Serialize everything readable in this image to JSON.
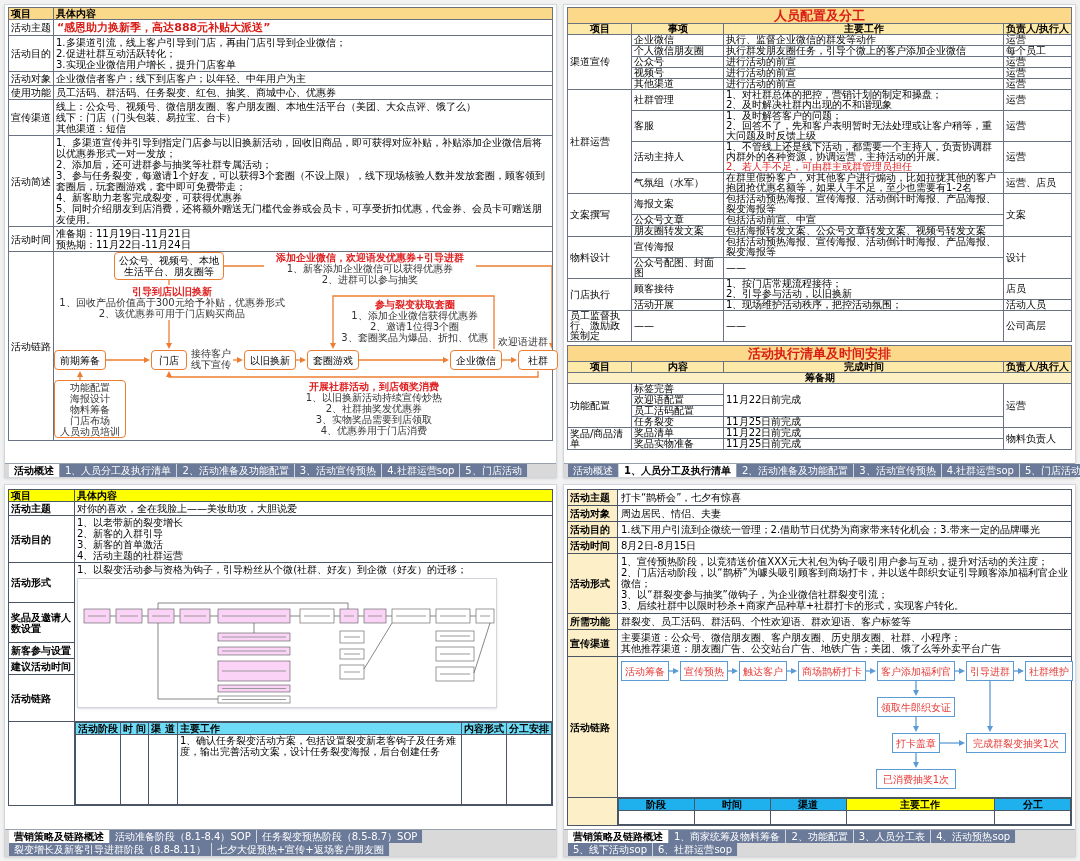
{
  "sheet_1": {
    "header": [
      "项目",
      "具体内容"
    ],
    "rows": [
      {
        "label": "活动主题",
        "kind": "headline",
        "lines": [
          "“感恩助力换新季，高达888元补贴大派送”"
        ]
      },
      {
        "label": "活动目的",
        "kind": "text",
        "lines": [
          "1.多渠道引流，线上客户引导到门店，再由门店引导到企业微信；",
          "2.促进社群互动活跃转化；",
          "3.实现企业微信用户增长，提升门店客单"
        ]
      },
      {
        "label": "活动对象",
        "kind": "text",
        "lines": [
          "企业微信者客户；线下到店客户；以年轻、中年用户为主"
        ]
      },
      {
        "label": "使用功能",
        "kind": "text",
        "lines": [
          "员工活码、群活码、任务裂变、红包、抽奖、商城中心、优惠券"
        ]
      },
      {
        "label": "宣传渠道",
        "kind": "text",
        "lines": [
          "线上：公众号、视频号、微信朋友圈、客户朋友圈、本地生活平台（美团、大众点评、饿了么）",
          "线下：门店（门头包装、易拉宝、台卡）",
          "其他渠道：短信"
        ]
      },
      {
        "label": "活动简述",
        "kind": "text",
        "lines": [
          "1、多渠道宣传并引导到指定门店参与以旧换新活动，回收旧商品，即可获得对应补贴，补贴添加企业微信后将以优惠券形式一对一发放；",
          "2、添加后，还可进群参与抽奖等社群专属活动；",
          "3、参与任务裂变，每邀请1个好友，可以获得3个套圈（不设上限），线下现场核验人数并发放套圈，顾客领到套圈后，玩套圈游戏，套中即可免费带走；",
          "4、新客助力老客完成裂变，可获得优惠券",
          "5、同时介绍朋友到店消费，还将额外赠送无门槛代金券或会员卡，可享受折扣优惠，代金券、会员卡可赠送朋友使用。"
        ]
      },
      {
        "label": "活动时间",
        "kind": "text",
        "lines": [
          "准备期：11月19日-11月21日",
          "预热期：11月22日-11月24日"
        ]
      }
    ],
    "flow": {
      "label": "活动链路",
      "source": "公众号、视频号、本地生活平台、朋友圈等",
      "steps": [
        "前期筹备",
        "门店",
        "以旧换新",
        "套圈游戏",
        "企业微信",
        "社群"
      ],
      "edge_labels": [
        [
          "接待客户",
          "线下宣传"
        ],
        [
          "欢迎语进群"
        ]
      ],
      "prep_items": [
        "功能配置",
        "海报设计",
        "物料筹备",
        "门店布场",
        "人员动员培训"
      ],
      "notes": [
        {
          "title": "添加企业微信，欢迎语发优惠券+引导进群",
          "items": [
            "1、新客添加企业微信可以获得优惠券",
            "2、进群可以参与抽奖"
          ]
        },
        {
          "title": "引导到店以旧换新",
          "items": [
            "1、回收产品价值高于300元给予补贴，优惠券形式",
            "2、该优惠券可用于门店购买商品"
          ]
        },
        {
          "title": "参与裂变获取套圈",
          "items": [
            "1、添加企业微信获得优惠券",
            "2、邀请1位得3个圈",
            "3、套圈奖品为爆品、折扣、优惠"
          ]
        },
        {
          "title": "开展社群活动，到店领奖消费",
          "items": [
            "1、以旧换新活动持续宣传炒热",
            "2、社群抽奖发优惠券",
            "3、实物奖品需要到店领取",
            "4、优惠券用于门店消费"
          ]
        }
      ]
    },
    "tabs": [
      {
        "label": "活动概述",
        "selected": true
      },
      {
        "label": "1、人员分工及执行清单",
        "selected": false
      },
      {
        "label": "2、活动准备及功能配置",
        "selected": false
      },
      {
        "label": "3、活动宣传预热",
        "selected": false
      },
      {
        "label": "4.社群运营sop",
        "selected": false
      },
      {
        "label": "5、门店活动",
        "selected": false
      }
    ]
  },
  "sheet_2": {
    "staff_table": {
      "title": "人员配置及分工",
      "columns": [
        "项目",
        "事项",
        "主要工作",
        "负责人/执行人"
      ],
      "groups": [
        {
          "label": "渠道宣传",
          "items": [
            {
              "task": "企业微信",
              "work": [
                "执行、监督企业微信的群发等动作"
              ],
              "owner": "运营"
            },
            {
              "task": "个人微信朋友圈",
              "work": [
                "执行群发朋友圈任务，引导个微上的客户添加企业微信"
              ],
              "owner": "每个员工"
            },
            {
              "task": "公众号",
              "work": [
                "进行活动的前宣"
              ],
              "owner": "运营"
            },
            {
              "task": "视频号",
              "work": [
                "进行活动的前宣"
              ],
              "owner": "运营"
            },
            {
              "task": "其他渠道",
              "work": [
                "进行活动的前宣"
              ],
              "owner": "运营"
            }
          ]
        },
        {
          "label": "社群运营",
          "items": [
            {
              "task": "社群管理",
              "work": [
                "1、对社群总体的把控，营销计划的制定和操盘；",
                "2、及时解决社群内出现的不和谐现象"
              ],
              "owner": "运营"
            },
            {
              "task": "客服",
              "work": [
                "1、及时解答客户的问题；",
                "2、回答不了，先和客户表明暂时无法处理或让客户稍等，重大问题及时反馈上级"
              ],
              "owner": "运营"
            },
            {
              "task": "活动主持人",
              "work": [
                "1、不管线上还是线下活动，都需要一个主持人，负责协调群内群外的各种资源，协调运营，主持活动的开展。"
              ],
              "note": "2、若人手不足，可由群主或群管理员担任",
              "owner": "运营"
            },
            {
              "task": "气氛组（水军）",
              "work": [
                "在群里假扮客户，对其他客户进行煽动，比如拉拢其他的客户抱团抢优惠名额等，如果人手不足，至少也需要有1-2名"
              ],
              "owner": "运营、店员"
            }
          ]
        },
        {
          "label": "文案撰写",
          "owner": "文案",
          "items": [
            {
              "task": "海报文案",
              "work": [
                "包括活动预热海报、宣传海报、活动倒计时海报、产品海报、裂变海报等"
              ]
            },
            {
              "task": "公众号文章",
              "work": [
                "包括活动前宣、中宣"
              ]
            },
            {
              "task": "朋友圈转发文案",
              "work": [
                "包括海报转发文案、公众号文章转发文案、视频号转发文案"
              ]
            }
          ]
        },
        {
          "label": "物料设计",
          "owner": "设计",
          "items": [
            {
              "task": "宣传海报",
              "work": [
                "包括活动预热海报、宣传海报、活动倒计时海报、产品海报、裂变海报等"
              ]
            },
            {
              "task": "公众号配图、封面图",
              "work": [
                "——"
              ]
            }
          ]
        },
        {
          "label": "门店执行",
          "items": [
            {
              "task": "顾客接待",
              "work": [
                "1、按门店常规流程接待；",
                "2、引导参与活动，以旧换新"
              ],
              "owner": "店员"
            },
            {
              "task": "活动开展",
              "work": [
                "1、现场维护活动秩序，把控活动氛围；"
              ],
              "owner": "活动人员"
            }
          ]
        },
        {
          "label": "员工监督执行、激励政策制定",
          "items": [
            {
              "task": "——",
              "work": [
                "——"
              ],
              "owner": "公司高层"
            }
          ]
        }
      ]
    },
    "schedule_table": {
      "title": "活动执行清单及时间安排",
      "columns": [
        "项目",
        "内容",
        "完成时间",
        "负责人/执行人"
      ],
      "phase": "筹备期",
      "groups": [
        {
          "label": "功能配置",
          "owner": "运营",
          "blocks": [
            {
              "time": "11月22日前完成",
              "contents": [
                "标签完善",
                "欢迎语配置",
                "员工活码配置"
              ]
            },
            {
              "time": "11月25日前完成",
              "contents": [
                "任务裂变"
              ]
            }
          ]
        },
        {
          "label": "奖品/商品清单",
          "owner": "物料负责人",
          "blocks": [
            {
              "time": "11月22日前完成",
              "contents": [
                "奖品清单"
              ]
            },
            {
              "time": "11月25日前完成",
              "contents": [
                "奖品实物准备"
              ]
            }
          ]
        }
      ]
    },
    "tabs": [
      {
        "label": "活动概述",
        "selected": false
      },
      {
        "label": "1、人员分工及执行清单",
        "selected": true
      },
      {
        "label": "2、活动准备及功能配置",
        "selected": false
      },
      {
        "label": "3、活动宣传预热",
        "selected": false
      },
      {
        "label": "4.社群运营sop",
        "selected": false
      },
      {
        "label": "5、门店活动",
        "selected": false
      }
    ]
  },
  "sheet_3": {
    "header": [
      "项目",
      "具体内容"
    ],
    "rows": [
      {
        "label": "活动主题",
        "lines": [
          "对你的喜欢，全在我脸上——美妆助攻，大胆说爱"
        ]
      },
      {
        "label": "活动目的",
        "lines": [
          "1、以老带新的裂变增长",
          "2、新客的入群引导",
          "3、新客的首单激活",
          "4、活动主题的社群运营"
        ]
      }
    ],
    "form": {
      "labels": [
        "活动形式",
        "奖品及邀请人数设置",
        "新客参与设置",
        "建议活动时间",
        "活动链路"
      ],
      "text": "1、以裂变活动参与资格为钩子，引导粉丝从个微(社群、好友）到企微（好友）的迁移；"
    },
    "plan": {
      "columns": [
        "活动阶段",
        "时 间",
        "渠 道",
        "主要工作",
        "内容形式",
        "分工安排"
      ],
      "work": "1、确认任务裂变活动方案，包括设置裂变新老客钩子及任务难度，输出完善活动文案，设计任务裂变海报，后台创建任务"
    },
    "tabs": [
      {
        "label": "营销策略及链路概述",
        "selected": true
      },
      {
        "label": "活动准备阶段（8.1-8.4）SOP",
        "selected": false
      },
      {
        "label": "任务裂变预热阶段（8.5-8.7）SOP",
        "selected": false
      },
      {
        "label": "裂变增长及新客引导进群阶段（8.8-8.11）",
        "selected": false
      },
      {
        "label": "七夕大促预热+宣传+返场客户朋友圈",
        "selected": false
      }
    ]
  },
  "sheet_4": {
    "rows": [
      {
        "label": "活动主题",
        "lines": [
          "打卡“鹊桥会”，七夕有惊喜"
        ]
      },
      {
        "label": "活动对象",
        "lines": [
          "周边居民、情侣、夫妻"
        ]
      },
      {
        "label": "活动目的",
        "lines": [
          "1.线下用户引流到企微统一管理；2.借助节日优势为商家带来转化机会；3.带来一定的品牌曝光"
        ]
      },
      {
        "label": "活动时间",
        "lines": [
          "8月2日-8月15日"
        ]
      },
      {
        "label": "活动形式",
        "lines": [
          "1、宣传预热阶段，以竞猜送价值XXX元大礼包为钩子吸引用户参与互动，提升对活动的关注度；",
          "2、门店活动阶段，以“鹊桥”为噱头吸引顾客到商场打卡，并以送牛郎织女证引导顾客添加福利官企业微信；",
          "3、以“群裂变参与抽奖”做钩子，为企业微信社群裂变引流；",
          "3、后续社群中以限时秒杀+商家产品种草+社群打卡的形式，实现客户转化。"
        ]
      },
      {
        "label": "所需功能",
        "lines": [
          "群裂变、员工活码、群活码、个性欢迎语、群欢迎语、客户标签等"
        ]
      },
      {
        "label": "宣传渠道",
        "lines": [
          "主要渠道：公众号、微信朋友圈、客户朋友圈、历史朋友圈、社群、小程序；",
          "其他推荐渠道：朋友圈广告、公交站台广告、地铁广告；美团、饿了么等外卖平台广告"
        ]
      }
    ],
    "flow": {
      "label": "活动链路",
      "steps": [
        "活动筹备",
        "宣传预热",
        "触达客户",
        "商场鹊桥打卡",
        "客户添加福利官",
        "引导进群",
        "社群维护"
      ],
      "branch": [
        "领取牛郎织女证",
        "打卡盖章",
        "已消费抽奖1次"
      ],
      "goal": "完成群裂变抽奖1次"
    },
    "plan": {
      "columns": [
        {
          "label": "阶段",
          "highlighted": false
        },
        {
          "label": "时间",
          "highlighted": false
        },
        {
          "label": "渠道",
          "highlighted": false
        },
        {
          "label": "主要工作",
          "highlighted": true
        },
        {
          "label": "分工",
          "highlighted": false
        }
      ]
    },
    "tabs": [
      {
        "label": "营销策略及链路概述",
        "selected": true
      },
      {
        "label": "1、商家统筹及物料筹备",
        "selected": false
      },
      {
        "label": "2、功能配置",
        "selected": false
      },
      {
        "label": "3、人员分工表",
        "selected": false
      },
      {
        "label": "4、活动预热sop",
        "selected": false
      },
      {
        "label": "5、线下活动sop",
        "selected": false
      },
      {
        "label": "6、社群运营sop",
        "selected": false
      }
    ]
  }
}
